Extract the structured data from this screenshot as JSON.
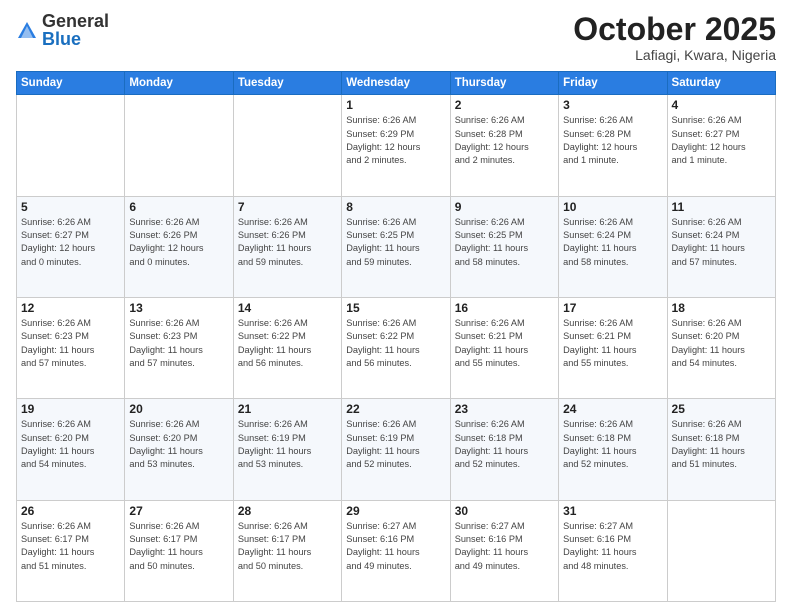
{
  "header": {
    "logo": {
      "general": "General",
      "blue": "Blue"
    },
    "title": "October 2025",
    "location": "Lafiagi, Kwara, Nigeria"
  },
  "days_of_week": [
    "Sunday",
    "Monday",
    "Tuesday",
    "Wednesday",
    "Thursday",
    "Friday",
    "Saturday"
  ],
  "weeks": [
    [
      {
        "day": "",
        "info": ""
      },
      {
        "day": "",
        "info": ""
      },
      {
        "day": "",
        "info": ""
      },
      {
        "day": "1",
        "info": "Sunrise: 6:26 AM\nSunset: 6:29 PM\nDaylight: 12 hours\nand 2 minutes."
      },
      {
        "day": "2",
        "info": "Sunrise: 6:26 AM\nSunset: 6:28 PM\nDaylight: 12 hours\nand 2 minutes."
      },
      {
        "day": "3",
        "info": "Sunrise: 6:26 AM\nSunset: 6:28 PM\nDaylight: 12 hours\nand 1 minute."
      },
      {
        "day": "4",
        "info": "Sunrise: 6:26 AM\nSunset: 6:27 PM\nDaylight: 12 hours\nand 1 minute."
      }
    ],
    [
      {
        "day": "5",
        "info": "Sunrise: 6:26 AM\nSunset: 6:27 PM\nDaylight: 12 hours\nand 0 minutes."
      },
      {
        "day": "6",
        "info": "Sunrise: 6:26 AM\nSunset: 6:26 PM\nDaylight: 12 hours\nand 0 minutes."
      },
      {
        "day": "7",
        "info": "Sunrise: 6:26 AM\nSunset: 6:26 PM\nDaylight: 11 hours\nand 59 minutes."
      },
      {
        "day": "8",
        "info": "Sunrise: 6:26 AM\nSunset: 6:25 PM\nDaylight: 11 hours\nand 59 minutes."
      },
      {
        "day": "9",
        "info": "Sunrise: 6:26 AM\nSunset: 6:25 PM\nDaylight: 11 hours\nand 58 minutes."
      },
      {
        "day": "10",
        "info": "Sunrise: 6:26 AM\nSunset: 6:24 PM\nDaylight: 11 hours\nand 58 minutes."
      },
      {
        "day": "11",
        "info": "Sunrise: 6:26 AM\nSunset: 6:24 PM\nDaylight: 11 hours\nand 57 minutes."
      }
    ],
    [
      {
        "day": "12",
        "info": "Sunrise: 6:26 AM\nSunset: 6:23 PM\nDaylight: 11 hours\nand 57 minutes."
      },
      {
        "day": "13",
        "info": "Sunrise: 6:26 AM\nSunset: 6:23 PM\nDaylight: 11 hours\nand 57 minutes."
      },
      {
        "day": "14",
        "info": "Sunrise: 6:26 AM\nSunset: 6:22 PM\nDaylight: 11 hours\nand 56 minutes."
      },
      {
        "day": "15",
        "info": "Sunrise: 6:26 AM\nSunset: 6:22 PM\nDaylight: 11 hours\nand 56 minutes."
      },
      {
        "day": "16",
        "info": "Sunrise: 6:26 AM\nSunset: 6:21 PM\nDaylight: 11 hours\nand 55 minutes."
      },
      {
        "day": "17",
        "info": "Sunrise: 6:26 AM\nSunset: 6:21 PM\nDaylight: 11 hours\nand 55 minutes."
      },
      {
        "day": "18",
        "info": "Sunrise: 6:26 AM\nSunset: 6:20 PM\nDaylight: 11 hours\nand 54 minutes."
      }
    ],
    [
      {
        "day": "19",
        "info": "Sunrise: 6:26 AM\nSunset: 6:20 PM\nDaylight: 11 hours\nand 54 minutes."
      },
      {
        "day": "20",
        "info": "Sunrise: 6:26 AM\nSunset: 6:20 PM\nDaylight: 11 hours\nand 53 minutes."
      },
      {
        "day": "21",
        "info": "Sunrise: 6:26 AM\nSunset: 6:19 PM\nDaylight: 11 hours\nand 53 minutes."
      },
      {
        "day": "22",
        "info": "Sunrise: 6:26 AM\nSunset: 6:19 PM\nDaylight: 11 hours\nand 52 minutes."
      },
      {
        "day": "23",
        "info": "Sunrise: 6:26 AM\nSunset: 6:18 PM\nDaylight: 11 hours\nand 52 minutes."
      },
      {
        "day": "24",
        "info": "Sunrise: 6:26 AM\nSunset: 6:18 PM\nDaylight: 11 hours\nand 52 minutes."
      },
      {
        "day": "25",
        "info": "Sunrise: 6:26 AM\nSunset: 6:18 PM\nDaylight: 11 hours\nand 51 minutes."
      }
    ],
    [
      {
        "day": "26",
        "info": "Sunrise: 6:26 AM\nSunset: 6:17 PM\nDaylight: 11 hours\nand 51 minutes."
      },
      {
        "day": "27",
        "info": "Sunrise: 6:26 AM\nSunset: 6:17 PM\nDaylight: 11 hours\nand 50 minutes."
      },
      {
        "day": "28",
        "info": "Sunrise: 6:26 AM\nSunset: 6:17 PM\nDaylight: 11 hours\nand 50 minutes."
      },
      {
        "day": "29",
        "info": "Sunrise: 6:27 AM\nSunset: 6:16 PM\nDaylight: 11 hours\nand 49 minutes."
      },
      {
        "day": "30",
        "info": "Sunrise: 6:27 AM\nSunset: 6:16 PM\nDaylight: 11 hours\nand 49 minutes."
      },
      {
        "day": "31",
        "info": "Sunrise: 6:27 AM\nSunset: 6:16 PM\nDaylight: 11 hours\nand 48 minutes."
      },
      {
        "day": "",
        "info": ""
      }
    ]
  ]
}
